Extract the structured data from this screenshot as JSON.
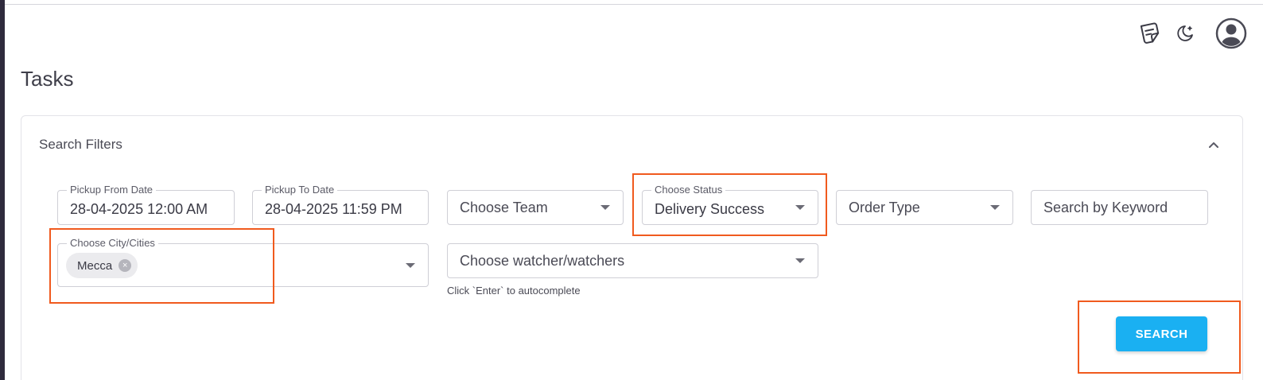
{
  "page": {
    "title": "Tasks"
  },
  "header_icons": [
    "notes-icon",
    "dark-mode-icon",
    "user-avatar-icon"
  ],
  "filters": {
    "title": "Search Filters",
    "pickup_from": {
      "label": "Pickup From Date",
      "value": "28-04-2025 12:00 AM"
    },
    "pickup_to": {
      "label": "Pickup To Date",
      "value": "28-04-2025 11:59 PM"
    },
    "team": {
      "placeholder": "Choose Team"
    },
    "status": {
      "label": "Choose Status",
      "value": "Delivery Success"
    },
    "order_type": {
      "placeholder": "Order Type"
    },
    "keyword": {
      "placeholder": "Search by Keyword"
    },
    "city": {
      "label": "Choose City/Cities",
      "chips": [
        "Mecca"
      ]
    },
    "watchers": {
      "placeholder": "Choose watcher/watchers",
      "helper": "Click `Enter` to autocomplete"
    },
    "search_label": "SEARCH"
  },
  "colors": {
    "accent": "#1ab0f2",
    "highlight": "#f05a1e",
    "rail": "#2f2b3d"
  }
}
